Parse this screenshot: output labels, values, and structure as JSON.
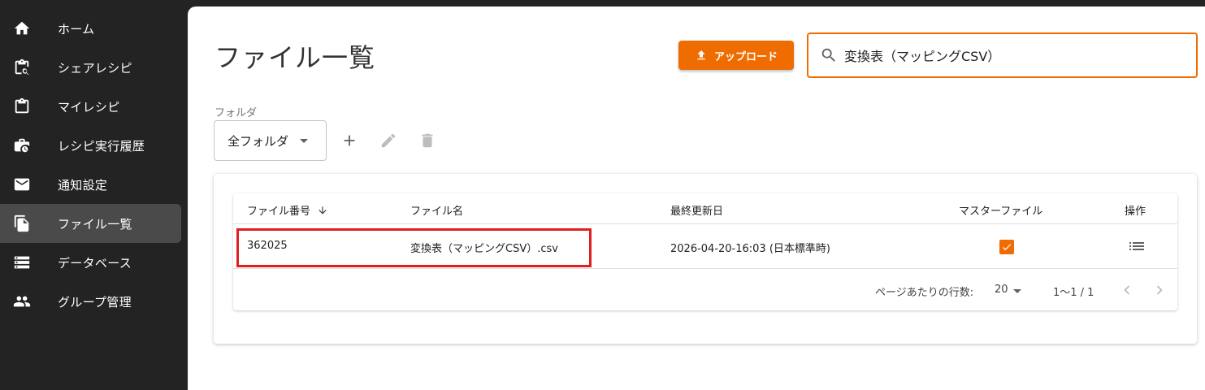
{
  "sidebar": {
    "items": [
      {
        "label": "ホーム",
        "icon": "home-icon"
      },
      {
        "label": "シェアレシピ",
        "icon": "clipboard-search-icon"
      },
      {
        "label": "マイレシピ",
        "icon": "clipboard-icon"
      },
      {
        "label": "レシピ実行履歴",
        "icon": "briefcase-clock-icon"
      },
      {
        "label": "通知設定",
        "icon": "mail-icon"
      },
      {
        "label": "ファイル一覧",
        "icon": "file-copy-icon",
        "active": true
      },
      {
        "label": "データベース",
        "icon": "storage-icon"
      },
      {
        "label": "グループ管理",
        "icon": "people-icon"
      }
    ]
  },
  "header": {
    "title": "ファイル一覧",
    "upload_label": "アップロード",
    "search_value": "変換表（マッピングCSV）"
  },
  "folder": {
    "caption": "フォルダ",
    "selected": "全フォルダ"
  },
  "table": {
    "columns": [
      "ファイル番号",
      "ファイル名",
      "最終更新日",
      "マスターファイル",
      "操作"
    ],
    "rows": [
      {
        "id": "362025",
        "name": "変換表（マッピングCSV）.csv",
        "updated": "2026-04-20-16:03 (日本標準時)",
        "master": true
      }
    ],
    "footer": {
      "rows_per_page_label": "ページあたりの行数:",
      "rows_per_page": "20",
      "range": "1〜1 / 1"
    }
  },
  "colors": {
    "accent": "#ef6c00",
    "sidebar_bg": "#232323",
    "highlight": "#e02020"
  }
}
